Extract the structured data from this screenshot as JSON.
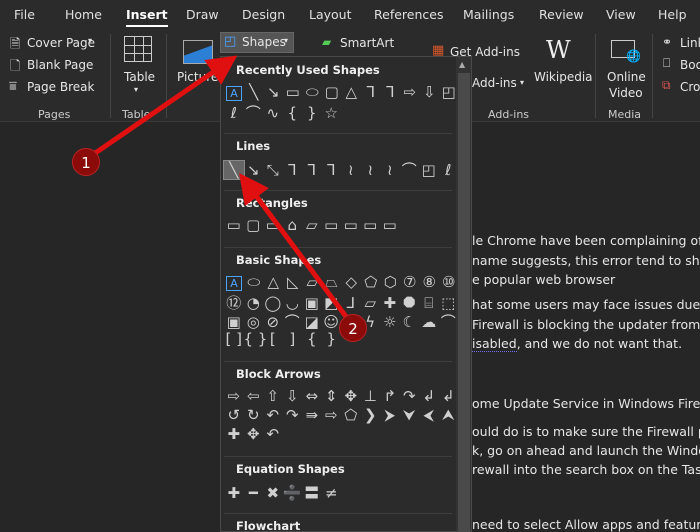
{
  "tabs": [
    "File",
    "Home",
    "Insert",
    "Draw",
    "Design",
    "Layout",
    "References",
    "Mailings",
    "Review",
    "View",
    "Help"
  ],
  "active_tab": "Insert",
  "ribbon": {
    "pages": {
      "cover_page": "Cover Page",
      "blank_page": "Blank Page",
      "page_break": "Page Break",
      "label": "Pages"
    },
    "table": {
      "button": "Table",
      "label": "Table"
    },
    "pictures": "Pictures",
    "shapes": "Shapes",
    "smartart": "SmartArt",
    "addins": {
      "get": "Get Add-ins",
      "my": "Add-ins",
      "wikipedia": "Wikipedia",
      "label": "Add-ins"
    },
    "media": {
      "online_video_1": "Online",
      "online_video_2": "Video",
      "label": "Media"
    },
    "links": {
      "link": "Link",
      "bookmark": "Boo",
      "cross_ref": "Cro"
    }
  },
  "shapes_menu": {
    "sections": [
      {
        "title": "Recently Used Shapes",
        "rows": [
          [
            "A",
            "╲",
            "↘",
            "▭",
            "⬭",
            "▢",
            "△",
            "⅂",
            "⅂",
            "⇨",
            "⇩",
            "◰"
          ],
          [
            "ℓ",
            "⌒",
            "∿",
            "{",
            "}",
            "☆"
          ]
        ]
      },
      {
        "title": "Lines",
        "rows": [
          [
            "╲",
            "↘",
            "⤡",
            "⅂",
            "⅂",
            "⅂",
            "≀",
            "≀",
            "≀",
            "⌒",
            "◰",
            "ℓ"
          ]
        ]
      },
      {
        "title": "Rectangles",
        "rows": [
          [
            "▭",
            "▢",
            "▭",
            "⌂",
            "▱",
            "▭",
            "▭",
            "▭",
            "▭"
          ]
        ]
      },
      {
        "title": "Basic Shapes",
        "rows": [
          [
            "A",
            "⬭",
            "△",
            "◺",
            "▱",
            "⏢",
            "◇",
            "⬠",
            "⬡",
            "⑦",
            "⑧",
            "⑩"
          ],
          [
            "⑫",
            "◔",
            "◯",
            "◡",
            "▣",
            "◩",
            "⅃",
            "▱",
            "✚",
            "⯃",
            "⌸",
            "⬚"
          ],
          [
            "▣",
            "◎",
            "⊘",
            "⌒",
            "◪",
            "☺",
            "♡",
            "ϟ",
            "☼",
            "☾",
            "☁",
            "⌒"
          ],
          [
            "[ ]",
            "{ }",
            "[",
            "]",
            "{",
            "}"
          ]
        ]
      },
      {
        "title": "Block Arrows",
        "rows": [
          [
            "⇨",
            "⇦",
            "⇧",
            "⇩",
            "⇔",
            "⇕",
            "✥",
            "⊥",
            "↱",
            "↷",
            "↲",
            "↲"
          ],
          [
            "↺",
            "↻",
            "↶",
            "↷",
            "⇛",
            "⇨",
            "⬠",
            "❯",
            "⮞",
            "⮟",
            "⮜",
            "⮝"
          ],
          [
            "✚",
            "✥",
            "↶"
          ]
        ]
      },
      {
        "title": "Equation Shapes",
        "rows": [
          [
            "✚",
            "━",
            "✖",
            "➗",
            "〓",
            "≠"
          ]
        ]
      },
      {
        "title": "Flowchart",
        "rows": []
      }
    ]
  },
  "document": {
    "lines": [
      "le Chrome have been complaining of la",
      "name suggests, this error tend to show",
      "e popular web browser",
      "hat some users may face issues due to",
      "Firewall is blocking the updater from do",
      "isabled",
      ", and we do not want that.",
      "ome Update Service in Windows Firewa",
      "ould do is to make sure the Firewall pos",
      "k, go on ahead and launch the Window",
      "rewall into the search box on the Taskb",
      "need to select Allow apps and feature th"
    ]
  },
  "annotations": {
    "badge_1": "1",
    "badge_2": "2",
    "color": "#e01010"
  }
}
